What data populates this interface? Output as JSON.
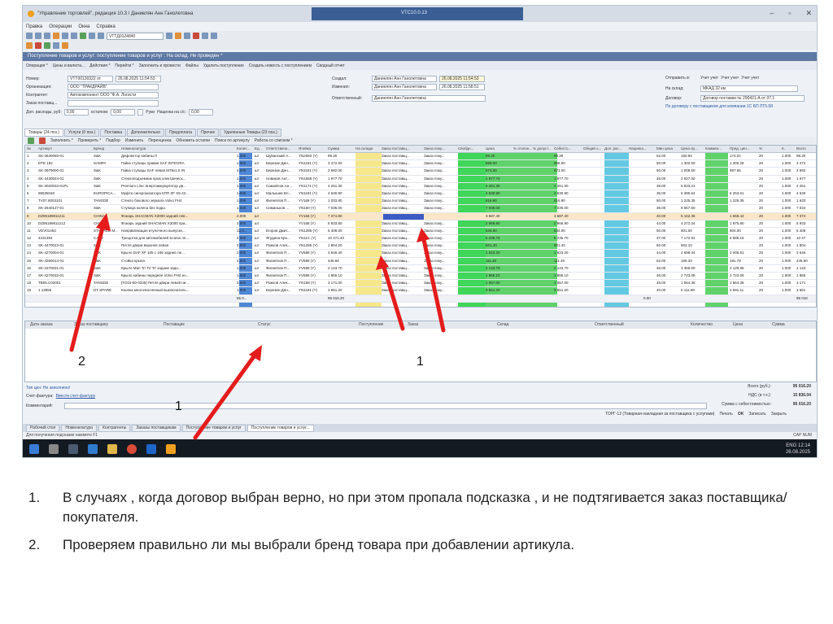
{
  "app_title": "\"Управление торговлей\", редакция 10.3 / Даниелян Анн Ганолетовна",
  "window_center_title": "VTC10.0.13",
  "menu": [
    "Правка",
    "Операции",
    "Окна",
    "Справка"
  ],
  "toolbar_field": "VTTД0124840",
  "document_title": "Поступление товаров и услуг: поступление товаров и услуг : На склад. Не проведен *",
  "actions": [
    "Операция *",
    "Цены и валюта...",
    "Действия *",
    "Перейти *",
    "Заполнить и провести",
    "Файлы",
    "Удалить поступление",
    "Создать новость с поступлением",
    "Сводный отчет"
  ],
  "form": {
    "number_label": "Номер:",
    "number": "VTT00130322 от",
    "date": "26.08.2025 11:54:53",
    "org_label": "Организация:",
    "org": "ООО \"ТРАКДРАЙВ\"",
    "contractor_label": "Контрагент:",
    "contractor": "Автокомпонент ООО \"Ф.А. Логисти",
    "supplier_order_label": "Заказ поставщ...",
    "expenses_label": "Доп. расходы, руб:",
    "expenses": "0,00",
    "residual_label": "остатков:",
    "residual": "0,00",
    "manual_label": "Руки",
    "markup_label": "Наценка на с/с:",
    "markup": "0,00",
    "created_label": "Создал:",
    "created": "Даниелян Анн Ганолетовна",
    "created_date": "26.08.2025 11:54:53",
    "changed_label": "Изменил:",
    "changed": "Даниелян Анн Ганолетовна",
    "changed_date": "26.08.2025 11:58:51",
    "resp_label": "Ответственный:",
    "resp": "Даниелян Анн Ганолетовна",
    "send_label": "Отправить в:",
    "send_opts": [
      "Учет учет",
      "Учет учет",
      "Учет учет"
    ],
    "warehouse_label": "На склад:",
    "warehouse": "МКАД 32 км",
    "contract_label": "Договор:",
    "contract": "Договор поставки № 290421-А от 07.1",
    "contract_link": "По договору с поставщиком для компании 1С БП ЛТ5.58"
  },
  "tabs": [
    "Товары (24 поз.)",
    "Услуги (0 поз.)",
    "Поставка",
    "Дополнительно",
    "Предоплата",
    "Прочее",
    "Удаленные Товары (23 поз.)"
  ],
  "grid_toolbar": [
    "Заполнить *",
    "Проверить *",
    "Подбор",
    "Изменить",
    "Перенценка",
    "Обновить остатки",
    "Поиск по артикулу",
    "Работа со списком *"
  ],
  "columns": [
    "№",
    "Артикул",
    "Бренд",
    "Номенклатура",
    "Колич...",
    "Ед.",
    "Ответственн...",
    "Ячейка",
    "Сумма",
    "На складе",
    "Заказ поставщ...",
    "Заказ поку...",
    "Свобдн...",
    "Цена",
    "% отклон...",
    "% допуст...",
    "Себесто...",
    "Общий о...",
    "Доп. рас...",
    "Наценка...",
    "Мин цена",
    "Цена пр...",
    "Коммен...",
    "Пред. цен...",
    "%",
    "К.",
    "Всего"
  ],
  "rows": [
    {
      "n": "1",
      "art": "SK-3530050-01",
      "brand": "S&K",
      "name": "Дефлектор кабины П",
      "qty": "1.000",
      "unit": "шт",
      "resp": "Шуванский А...",
      "cell": "YN2083 (Y)",
      "sum": "99.30",
      "order": "Заказ поставщ...",
      "buyer": "Заказ поку...",
      "price": "99.30",
      "cost": "99.30",
      "min": "52.00",
      "pp": "150.94",
      "prev": "174.04",
      "pct": "20",
      "k": "1.000",
      "total": "99.30"
    },
    {
      "n": "2",
      "art": "DTE 192",
      "brand": "SAMPA",
      "name": "Гайка ступицы правая SAF INTEGRA",
      "qty": "1.000",
      "unit": "шт",
      "resp": "Березин Ден...",
      "cell": "YN1181 (Y)",
      "sum": "3 472.00",
      "order": "Заказ поставщ...",
      "buyer": "Заказ поку...",
      "price": "868.00",
      "cost": "868.00",
      "min": "50.00",
      "pp": "1 302.00",
      "prev": "1 300.28",
      "pct": "20",
      "k": "1.000",
      "total": "3 472"
    },
    {
      "n": "3",
      "art": "SK-3979000-01",
      "brand": "S&K",
      "name": "Гайка ступицы SAF левая M76x1.5 IN",
      "qty": "4.000",
      "unit": "шт",
      "resp": "Березин Ден...",
      "cell": "YN1181 (Y)",
      "sum": "2 692.00",
      "order": "Заказ поставщ...",
      "buyer": "Заказ поку...",
      "price": "673.00",
      "cost": "673.00",
      "min": "50.00",
      "pp": "1 009.50",
      "prev": "997.65",
      "pct": "20",
      "k": "1.000",
      "total": "2 692"
    },
    {
      "n": "4",
      "art": "SK-4430024-01",
      "brand": "S&K",
      "name": "Стеклоподъемник пров.электрическ...",
      "qty": "1.000",
      "unit": "шт",
      "resp": "Новиков Акт...",
      "cell": "YN1568 (Y)",
      "sum": "1 977.70",
      "order": "Заказ поставщ...",
      "buyer": "Заказ поку...",
      "price": "1 977.70",
      "cost": "1 977.70",
      "min": "48.00",
      "pp": "2 927.00",
      "prev": "",
      "pct": "20",
      "k": "1.000",
      "total": "1 977"
    },
    {
      "n": "5",
      "art": "SK-3020033-01PL",
      "brand": "S&K",
      "name": "Premium Line Энергоаккумулятор дв...",
      "qty": "1.000",
      "unit": "шт",
      "resp": "Самойлов Ан...",
      "cell": "YN1171 (Y)",
      "sum": "4 261.30",
      "order": "Заказ поставщ...",
      "buyer": "Заказ поку...",
      "price": "4 261.30",
      "cost": "4 261.30",
      "min": "39.00",
      "pp": "5 923.21",
      "prev": "",
      "pct": "20",
      "k": "1.000",
      "total": "4 261"
    },
    {
      "n": "6",
      "art": "95535048",
      "brand": "EUROPICA...",
      "name": "Муфта синхронизатора КПП ZF S5-42...",
      "qty": "1.000",
      "unit": "шт",
      "resp": "Малышев Вл...",
      "cell": "YN1181 (Y)",
      "sum": "4 630.90",
      "order": "Заказ поставщ...",
      "buyer": "Заказ поку...",
      "price": "4 630.90",
      "cost": "4 630.90",
      "min": "35.00",
      "pp": "6 390.64",
      "prev": "6 253.61",
      "pct": "20",
      "k": "1.000",
      "total": "4 630"
    },
    {
      "n": "7",
      "art": "TV07.8003101",
      "brand": "TANGDE",
      "name": "Стекло бокового зеркала Volvo FH4",
      "qty": "1.000",
      "unit": "шт",
      "resp": "Филиппов П...",
      "cell": "YV168 (Y)",
      "sum": "1 033.80",
      "order": "Заказ поставщ...",
      "buyer": "Заказ поку...",
      "price": "816.90",
      "cost": "816.90",
      "min": "50.00",
      "pp": "1 225.35",
      "prev": "1 225.35",
      "pct": "20",
      "k": "1.000",
      "total": "1 633"
    },
    {
      "n": "8",
      "art": "SK-2640127-01",
      "brand": "S&K",
      "name": "Ступица колеса без подш.",
      "qty": "1.000",
      "unit": "шт",
      "resp": "Симаньков ...",
      "cell": "YN160 (Y)",
      "sum": "7 035.00",
      "order": "Заказ поставщ...",
      "buyer": "Заказ поку...",
      "price": "7 035.00",
      "cost": "7 035.00",
      "min": "36.00",
      "pp": "9 567.60",
      "prev": "",
      "pct": "20",
      "k": "1.000",
      "total": "7 034"
    },
    {
      "n": "9",
      "art": "DZ95189811211",
      "brand": "CHINA",
      "name": "Фонарь SHACMAN X3000 задний лев...",
      "qty": "2.000",
      "unit": "шт",
      "resp": "",
      "cell": "YV168 (Y)",
      "sum": "7 374.80",
      "order": "",
      "buyer": "",
      "price": "3 687.40",
      "cost": "3 687.40",
      "min": "40.00",
      "pp": "5 162.36",
      "prev": "1 669.44",
      "pct": "20",
      "k": "1.000",
      "total": "7 374"
    },
    {
      "n": "10",
      "art": "DZ95189811212",
      "brand": "CHINA",
      "name": "Фонарь задний SHACMAN X3000 пра...",
      "qty": "2.000",
      "unit": "шт",
      "resp": "",
      "cell": "YV168 (Y)",
      "sum": "5 933.80",
      "order": "Заказ поставщ...",
      "buyer": "Заказ поку...",
      "price": "2 966.90",
      "cost": "2 966.90",
      "min": "44.00",
      "pp": "4 272.34",
      "prev": "1 975.80",
      "pct": "20",
      "k": "1.000",
      "total": "5 933"
    },
    {
      "n": "11",
      "art": "VDV01463",
      "brand": "STARRED M...",
      "name": "Направляющая втулочного выпускн...",
      "qty": "12.0...",
      "unit": "шт",
      "resp": "Егоров Дмит...",
      "cell": "YN1285 (Y)",
      "sum": "6 408.00",
      "order": "Заказ поставщ...",
      "buyer": "Заказ поку...",
      "price": "534.00",
      "cost": "534.00",
      "min": "50.00",
      "pp": "801.00",
      "prev": "804.00",
      "pct": "20",
      "k": "1.000",
      "total": "6 408"
    },
    {
      "n": "12",
      "art": "4231394",
      "brand": "CAJU",
      "name": "Трещотка для автомобилей Scania ле...",
      "qty": "2.000",
      "unit": "шт",
      "resp": "Ягудина Крн...",
      "cell": "YN11C (Y)",
      "sum": "10 471.40",
      "order": "Заказ поставщ...",
      "buyer": "Заказ поку...",
      "price": "5 235.70",
      "cost": "5 235.70",
      "min": "37.00",
      "pp": "7 172.91",
      "prev": "6 586.19",
      "pct": "20",
      "k": "1.000",
      "total": "10 47"
    },
    {
      "n": "13",
      "art": "SK-4470023-01",
      "brand": "S&K",
      "name": "Петля двери верхняя левая",
      "qty": "3.000",
      "unit": "шт",
      "resp": "Рожков Алек...",
      "cell": "YN1285 (Y)",
      "sum": "1 804.20",
      "order": "Заказ поставщ...",
      "buyer": "Заказ поку...",
      "price": "601.40",
      "cost": "601.40",
      "min": "50.00",
      "pp": "902.10",
      "prev": "",
      "pct": "20",
      "k": "1.000",
      "total": "1 804"
    },
    {
      "n": "14",
      "art": "SK-4270004-01",
      "brand": "S&K",
      "name": "Крыло DAF XF 105 с 106 заднее ле...",
      "qty": "2.000",
      "unit": "шт",
      "resp": "Филиппов П...",
      "cell": "YV588 (Y)",
      "sum": "3 646.40",
      "order": "Заказ поставщ...",
      "buyer": "Заказ поку...",
      "price": "1 823.20",
      "cost": "1 823.20",
      "min": "44.00",
      "pp": "2 698.34",
      "prev": "2 005.51",
      "pct": "20",
      "k": "1.000",
      "total": "3 646"
    },
    {
      "n": "15",
      "art": "SK-4260014-01",
      "brand": "S&K",
      "name": "Стойка крыла",
      "qty": "4.000",
      "unit": "шт",
      "resp": "Филиппов П...",
      "cell": "YV588 (Y)",
      "sum": "445.60",
      "order": "Заказ поставщ...",
      "buyer": "Заказ поку...",
      "price": "111.40",
      "cost": "111.40",
      "min": "52.00",
      "pp": "169.33",
      "prev": "181.79",
      "pct": "20",
      "k": "1.000",
      "total": "445.60"
    },
    {
      "n": "16",
      "art": "SK-4270031-01",
      "brand": "S&K",
      "name": "Крыло Man Tr/ Tr/ Tr/ задние задн...",
      "qty": "1.000",
      "unit": "шт",
      "resp": "Филиппов П...",
      "cell": "YV588 (Y)",
      "sum": "2 143.70",
      "order": "Заказ поставщ...",
      "buyer": "Заказ поку...",
      "price": "2 143.70",
      "cost": "2 143.70",
      "min": "46.00",
      "pp": "3 355.00",
      "prev": "3 129.86",
      "pct": "20",
      "k": "1.000",
      "total": "2 143"
    },
    {
      "n": "17",
      "art": "SK-4270032-01",
      "brand": "S&K",
      "name": "Крыло кабины переднее Volvo FH4 но...",
      "qty": "1.000",
      "unit": "шт",
      "resp": "Филиппов П...",
      "cell": "YV588 (Y)",
      "sum": "1 865.10",
      "order": "Заказ поставщ...",
      "buyer": "Заказ поку...",
      "price": "1 865.10",
      "cost": "1 865.10",
      "min": "46.00",
      "pp": "2 723.05",
      "prev": "2 723.05",
      "pct": "20",
      "k": "1.000",
      "total": "1 865"
    },
    {
      "n": "18",
      "art": "TB05.C02001",
      "brand": "TANGDE",
      "name": "[TO15-50-0345] Петля двери левой ни...",
      "qty": "3.000",
      "unit": "шт",
      "resp": "Рожков Алек...",
      "cell": "YN168 (Y)",
      "sum": "3 171.00",
      "order": "Заказ поставщ...",
      "buyer": "Заказ поку...",
      "price": "1 057.00",
      "cost": "1 057.00",
      "min": "48.00",
      "pp": "1 564.36",
      "prev": "1 564.36",
      "pct": "20",
      "k": "1.000",
      "total": "3 171"
    },
    {
      "n": "19",
      "art": "1 13955",
      "brand": "DT SPARE",
      "name": "Кнопка многочисленный выключатель...",
      "qty": "1.000",
      "unit": "шт",
      "resp": "Березин Ден...",
      "cell": "YN1181 (Y)",
      "sum": "3 651.20",
      "order": "Заказ поставщ...",
      "buyer": "Заказ поку...",
      "price": "3 651.20",
      "cost": "3 651.20",
      "min": "40.00",
      "pp": "5 111.68",
      "prev": "4 691.11",
      "pct": "20",
      "k": "1.000",
      "total": "3 651"
    }
  ],
  "grid_totals": {
    "qty": "55.0...",
    "sum": "95 016.20",
    "zero": "0.00",
    "total": "95 016"
  },
  "sub_columns": [
    "Дата заказа",
    "Заказ поставщику",
    "Поставщик",
    "Статус",
    "Поступление",
    "Заказ",
    "Склад",
    "Ответственный",
    "Количество",
    "Цена",
    "Сумма"
  ],
  "footer": {
    "type_price_label": "Тип цен: Не заполнено!",
    "invoice_label": "Счет-фактура:",
    "invoice_link": "Ввести счет-фактуру",
    "comment_label": "Комментарий:",
    "total_label": "Всего (руб.):",
    "total": "95 016.20",
    "vat_label": "НДС (в т.ч.):",
    "vat": "15 836.04",
    "cost_label": "Сумма с себестоимостью:",
    "cost": "95 016.20",
    "buttons": [
      "ТОРГ-12 (Товарная накладная за поставщика с услугами)",
      "Печать",
      "OK",
      "Записать",
      "Закрыть"
    ]
  },
  "taskstrip": [
    "Рабочий стол",
    "Номенклатура",
    "Контрагенты",
    "Заказы поставщикам",
    "Поступление товаров и услуг",
    "Поступление товаров и услуг..."
  ],
  "status_line": "Для получения подсказки нажмите F1",
  "status_right": "CAP NUM",
  "tray": {
    "lang": "ENG",
    "time": "12:14",
    "date": "26.08.2025"
  },
  "annotations": {
    "arrow_left": "2",
    "arrow_bottom": "1",
    "arrow_right": "1"
  },
  "notes": [
    {
      "n": "1.",
      "text": "В случаях , когда договор выбран верно, но при этом пропала подсказка , и не подтягивается заказ поставщика/покупателя."
    },
    {
      "n": "2.",
      "text": "Проверяем правильно ли мы выбрали бренд товара при добавлении артикула."
    }
  ],
  "colors": {
    "accent": "#5e79a3",
    "green": "#2fd44a",
    "cyan": "#5bc6e0",
    "yellow": "#f5e56a",
    "arrow": "#e41c1c",
    "taskbar": "#141a22"
  }
}
